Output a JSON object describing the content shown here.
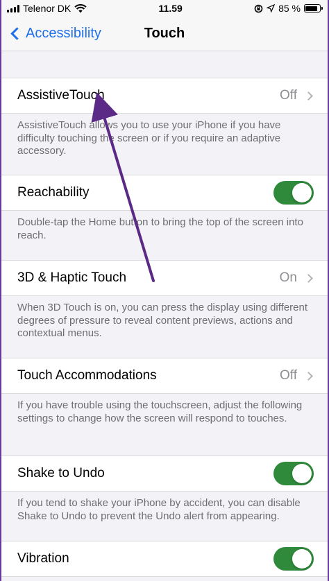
{
  "status_bar": {
    "carrier": "Telenor DK",
    "time": "11.59",
    "battery": "85 %",
    "battery_level": 0.85
  },
  "nav": {
    "back_label": "Accessibility",
    "title": "Touch"
  },
  "rows": [
    {
      "label": "AssistiveTouch",
      "control": "disclosure",
      "value": "Off",
      "footer": "AssistiveTouch allows you to use your iPhone if you have difficulty touching the screen or if you require an adaptive accessory."
    },
    {
      "label": "Reachability",
      "control": "toggle",
      "on": true,
      "footer": "Double-tap the Home button to bring the top of the screen into reach."
    },
    {
      "label": "3D & Haptic Touch",
      "control": "disclosure",
      "value": "On",
      "footer": "When 3D Touch is on, you can press the display using different degrees of pressure to reveal content previews, actions and contextual menus."
    },
    {
      "label": "Touch Accommodations",
      "control": "disclosure",
      "value": "Off",
      "footer": "If you have trouble using the touchscreen, adjust the following settings to change how the screen will respond to touches."
    },
    {
      "label": "Shake to Undo",
      "control": "toggle",
      "on": true,
      "footer": "If you tend to shake your iPhone by accident, you can disable Shake to Undo to prevent the Undo alert from appearing."
    },
    {
      "label": "Vibration",
      "control": "toggle",
      "on": true,
      "footer": ""
    }
  ],
  "colors": {
    "accent": "#1f6fe8",
    "toggle_on": "#2f8a3b",
    "annotation_arrow": "#5b2a86"
  },
  "annotation": {
    "icon": "arrow-pointer-icon"
  }
}
